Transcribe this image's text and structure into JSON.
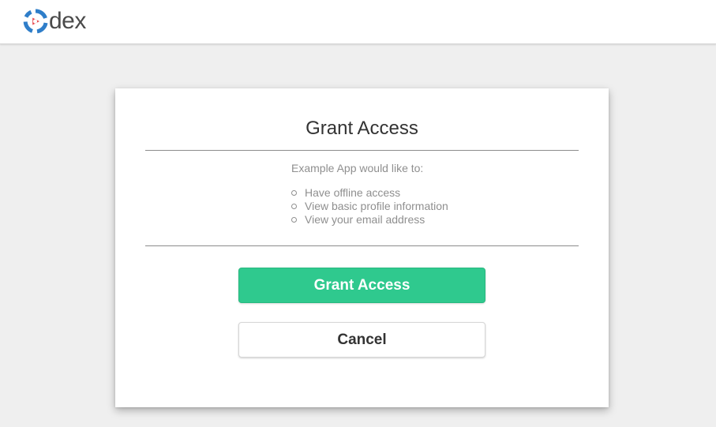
{
  "header": {
    "logo_text": "dex",
    "logo_icon": "dex-logo-icon"
  },
  "card": {
    "title": "Grant Access",
    "intro": "Example App would like to:",
    "scopes": [
      "Have offline access",
      "View basic profile information",
      "View your email address"
    ],
    "grant_label": "Grant Access",
    "cancel_label": "Cancel"
  },
  "colors": {
    "background": "#efefef",
    "card": "#ffffff",
    "accent_green": "#2fc98e",
    "logo_blue": "#2f7ec9",
    "logo_red": "#e8464a",
    "muted_text": "#8f8f8f"
  }
}
